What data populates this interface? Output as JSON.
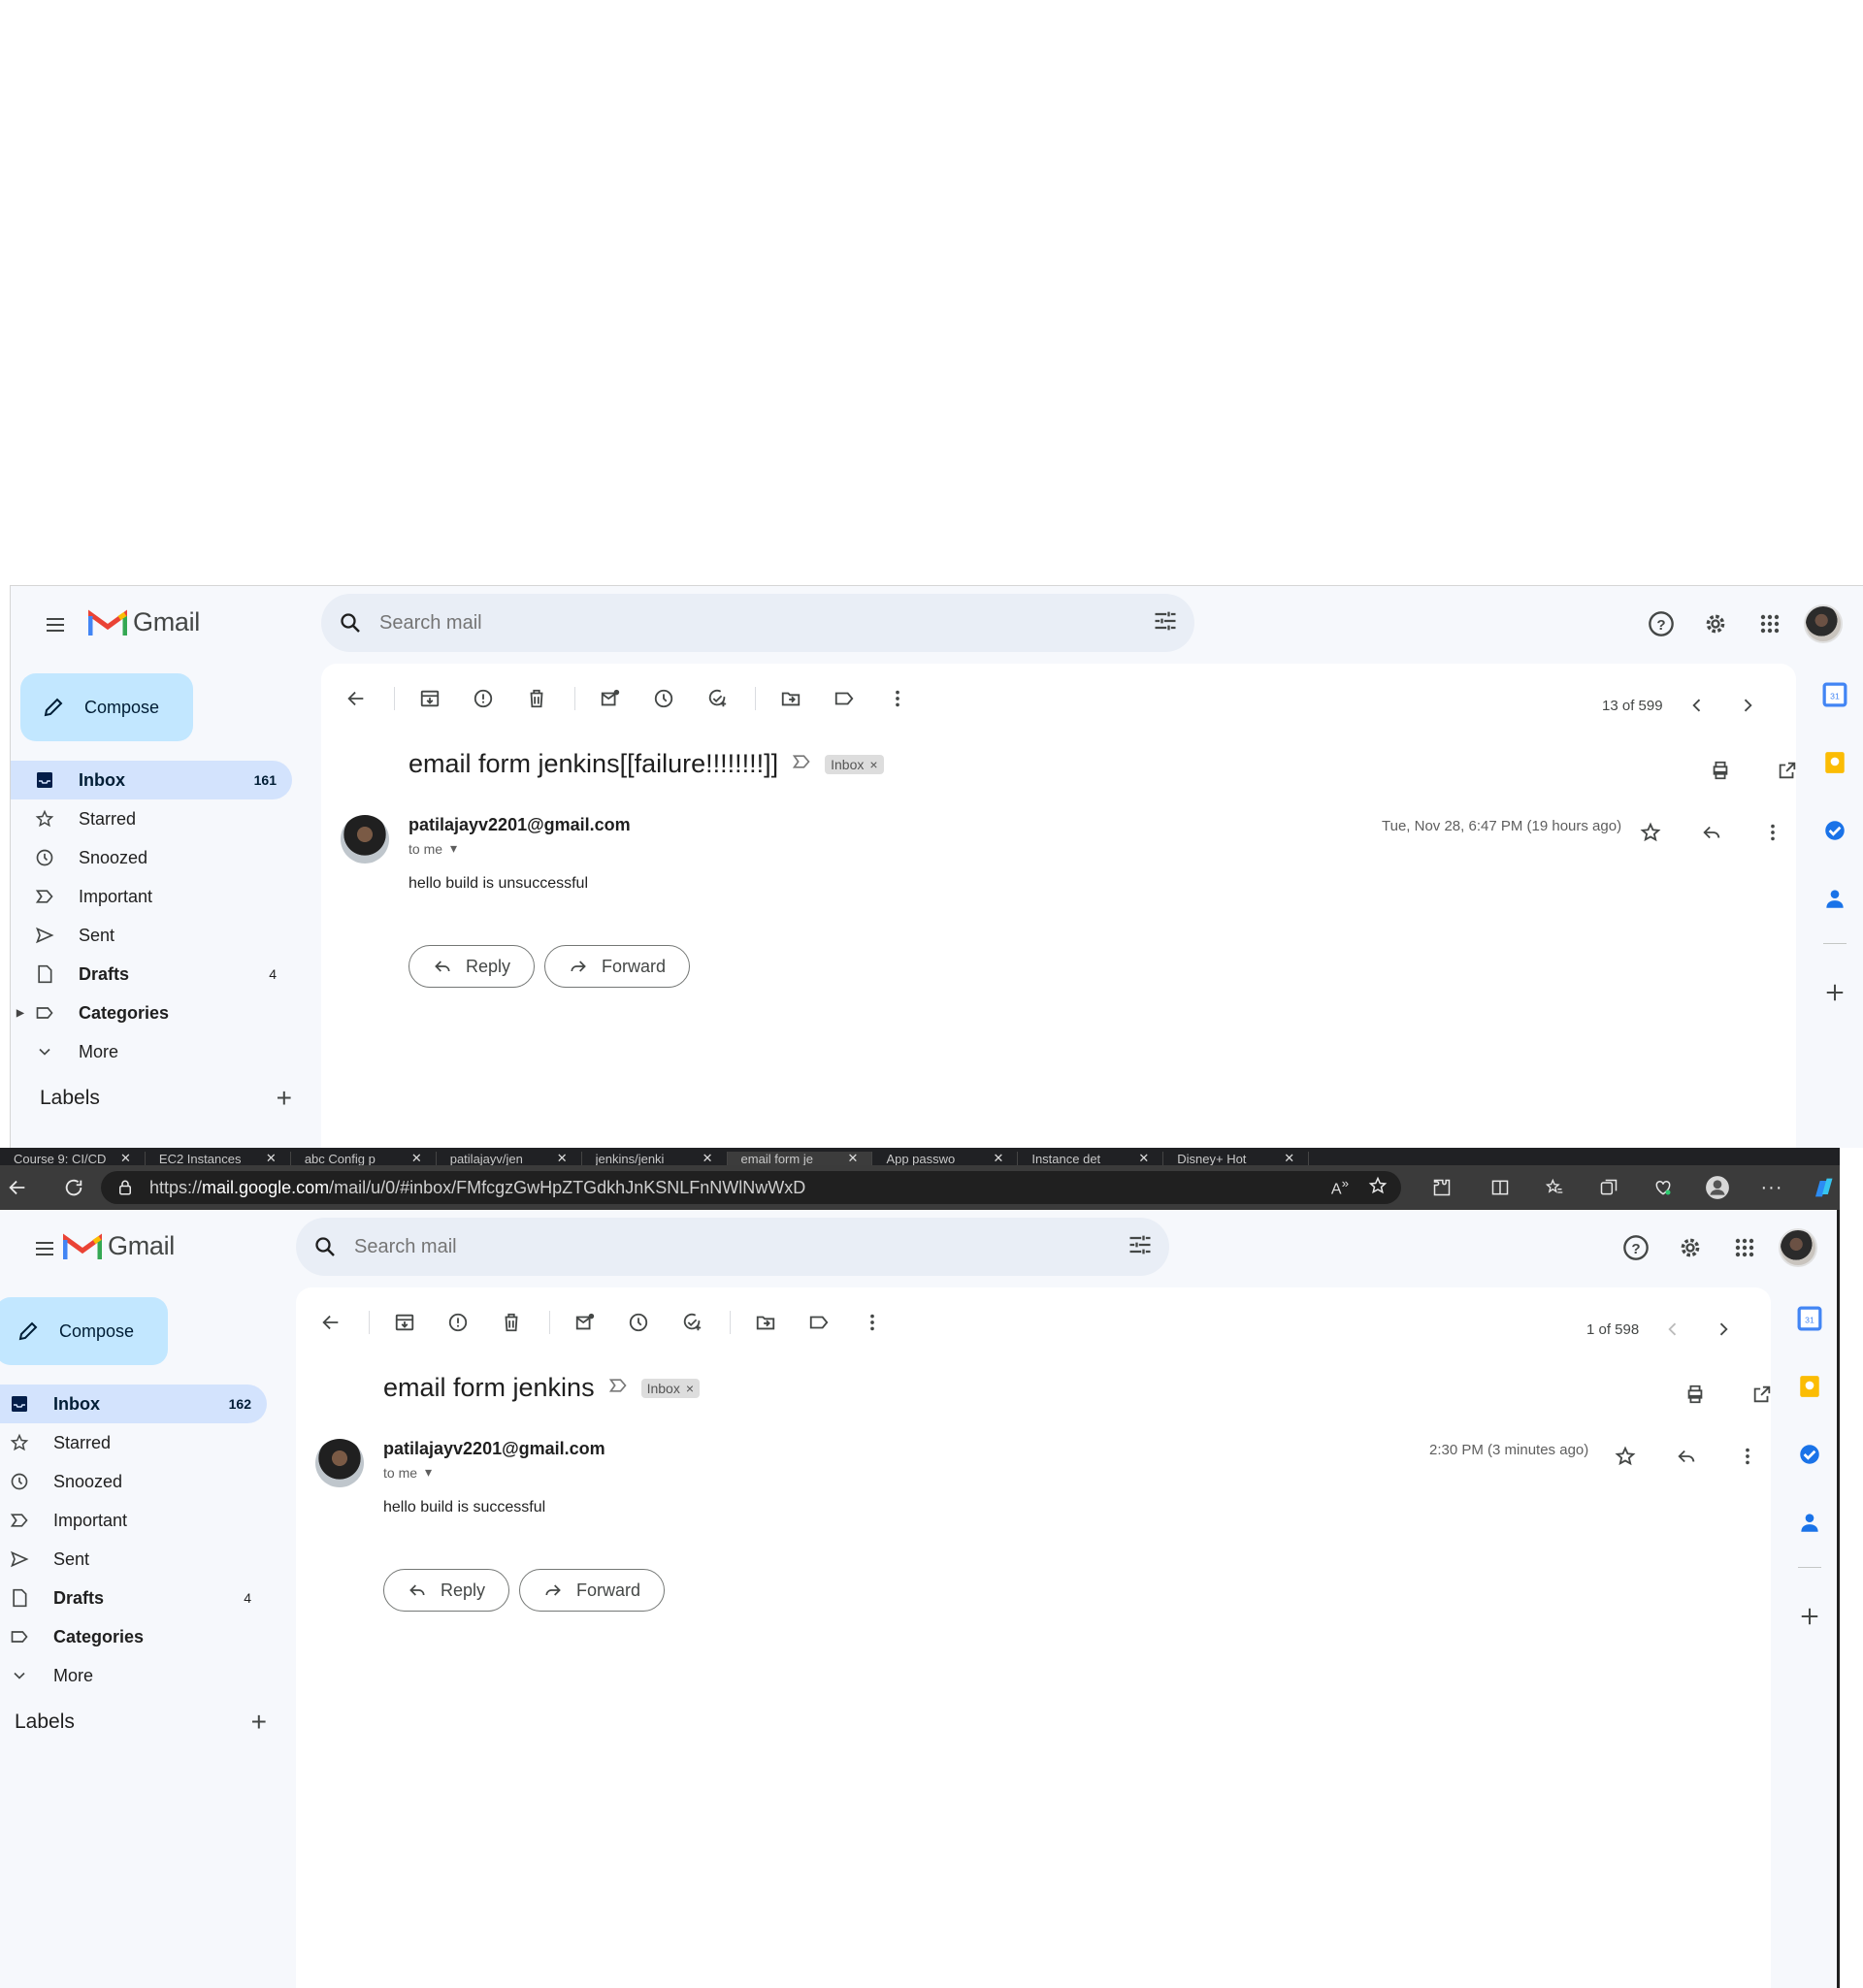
{
  "windows": [
    {
      "app_name": "Gmail",
      "search_placeholder": "Search mail",
      "compose_label": "Compose",
      "nav": [
        {
          "label": "Inbox",
          "count": "161",
          "icon": "inbox-icon"
        },
        {
          "label": "Starred",
          "count": "",
          "icon": "star-icon"
        },
        {
          "label": "Snoozed",
          "count": "",
          "icon": "clock-icon"
        },
        {
          "label": "Important",
          "count": "",
          "icon": "important-icon"
        },
        {
          "label": "Sent",
          "count": "",
          "icon": "send-icon"
        },
        {
          "label": "Drafts",
          "count": "4",
          "icon": "draft-icon"
        },
        {
          "label": "Categories",
          "count": "",
          "icon": "label-icon"
        },
        {
          "label": "More",
          "count": "",
          "icon": "chevron-down-icon"
        }
      ],
      "labels_heading": "Labels",
      "pager_text": "13 of 599",
      "subject": "email form jenkins[[failure!!!!!!!!]]",
      "chip": "Inbox",
      "sender": "patilajayv2201@gmail.com",
      "to_me": "to me",
      "date": "Tue, Nov 28, 6:47 PM (19 hours ago)",
      "body": "hello build is unsuccessful",
      "reply": "Reply",
      "forward": "Forward"
    },
    {
      "app_name": "Gmail",
      "search_placeholder": "Search mail",
      "compose_label": "Compose",
      "nav": [
        {
          "label": "Inbox",
          "count": "162",
          "icon": "inbox-icon"
        },
        {
          "label": "Starred",
          "count": "",
          "icon": "star-icon"
        },
        {
          "label": "Snoozed",
          "count": "",
          "icon": "clock-icon"
        },
        {
          "label": "Important",
          "count": "",
          "icon": "important-icon"
        },
        {
          "label": "Sent",
          "count": "",
          "icon": "send-icon"
        },
        {
          "label": "Drafts",
          "count": "4",
          "icon": "draft-icon"
        },
        {
          "label": "Categories",
          "count": "",
          "icon": "label-icon"
        },
        {
          "label": "More",
          "count": "",
          "icon": "chevron-down-icon"
        }
      ],
      "labels_heading": "Labels",
      "pager_text": "1 of 598",
      "subject": "email form jenkins",
      "chip": "Inbox",
      "sender": "patilajayv2201@gmail.com",
      "to_me": "to me",
      "date": "2:30 PM (3 minutes ago)",
      "body": "hello build is successful",
      "reply": "Reply",
      "forward": "Forward"
    }
  ],
  "browser": {
    "tabs": [
      "Course 9: CI/CD",
      "EC2 Instances",
      "abc Config p",
      "patilajayv/jen",
      "jenkins/jenki",
      "email form je",
      "App passwo",
      "Instance det",
      "Disney+ Hot"
    ],
    "url_prefix": "https://",
    "url_domain": "mail.google.com",
    "url_path": "/mail/u/0/#inbox/FMfcgzGwHpZTGdkhJnKSNLFnNWlNwWxD"
  },
  "colors": {
    "gmail_bg": "#f6f8fc",
    "compose": "#c2e7ff",
    "active_nav": "#d3e3fd",
    "search_bg": "#e9eef6",
    "browser_bar": "#3b3b3b"
  }
}
